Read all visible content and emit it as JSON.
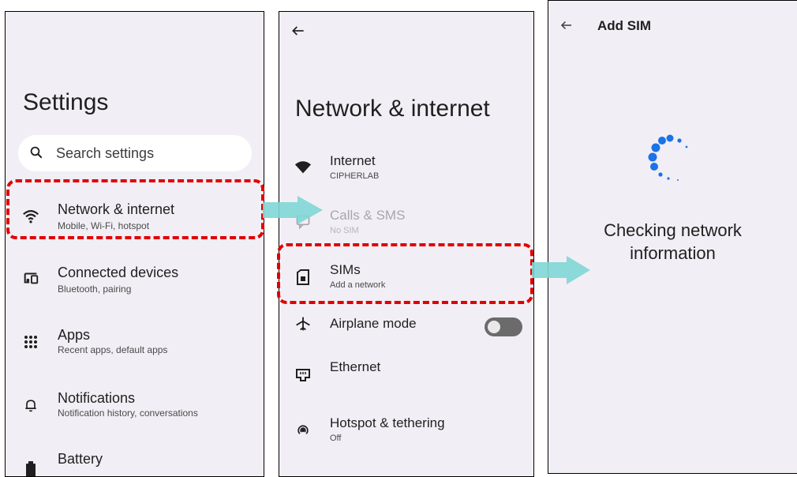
{
  "settings": {
    "title": "Settings",
    "search_placeholder": "Search settings",
    "items": [
      {
        "title": "Network & internet",
        "subtitle": "Mobile, Wi-Fi, hotspot",
        "icon": "wifi-icon"
      },
      {
        "title": "Connected devices",
        "subtitle": "Bluetooth, pairing",
        "icon": "connected-devices-icon"
      },
      {
        "title": "Apps",
        "subtitle": "Recent apps, default apps",
        "icon": "apps-grid-icon"
      },
      {
        "title": "Notifications",
        "subtitle": "Notification history, conversations",
        "icon": "bell-icon"
      },
      {
        "title": "Battery",
        "subtitle": "",
        "icon": "battery-icon"
      }
    ]
  },
  "network": {
    "title": "Network & internet",
    "items": [
      {
        "title": "Internet",
        "subtitle": "CIPHERLAB",
        "icon": "wifi-filled-icon"
      },
      {
        "title": "Calls & SMS",
        "subtitle": "No SIM",
        "icon": "calls-sms-icon"
      },
      {
        "title": "SIMs",
        "subtitle": "Add a network",
        "icon": "sim-card-icon"
      },
      {
        "title": "Airplane mode",
        "subtitle": "",
        "icon": "airplane-icon",
        "toggle": "off"
      },
      {
        "title": "Ethernet",
        "subtitle": "",
        "icon": "ethernet-icon"
      },
      {
        "title": "Hotspot & tethering",
        "subtitle": "Off",
        "icon": "hotspot-icon"
      }
    ]
  },
  "add_sim": {
    "title": "Add SIM",
    "status_line1": "Checking network",
    "status_line2": "information"
  },
  "colors": {
    "highlight": "#e10000",
    "arrow": "#7fd6d6",
    "spinner": "#1a73e8",
    "panel_bg": "#f1eff5"
  }
}
